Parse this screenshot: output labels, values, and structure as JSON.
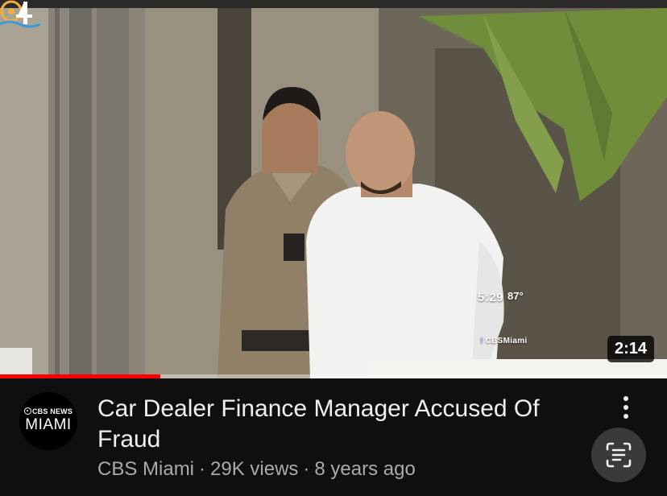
{
  "thumbnail": {
    "overlay_time": "5:29",
    "overlay_temp": "87°",
    "overlay_handle_icon": "f",
    "overlay_handle": "CBSMiami",
    "duration": "2:14",
    "progress_fraction": 0.24
  },
  "channel": {
    "avatar_top": "CBS NEWS",
    "avatar_bottom": "MIAMI",
    "name": "CBS Miami"
  },
  "video": {
    "title": "Car Dealer Finance Manager Accused Of Fraud",
    "views": "29K views",
    "age": "8 years ago",
    "separator": "·"
  },
  "icons": {
    "more": "more-vert-icon",
    "lens": "visual-search-icon",
    "channel_logo": "cbs-eye-icon"
  },
  "colors": {
    "background": "#0f0f0f",
    "progress": "#ff0000",
    "title": "#f1f1f1",
    "secondary": "#aaaaaa"
  }
}
